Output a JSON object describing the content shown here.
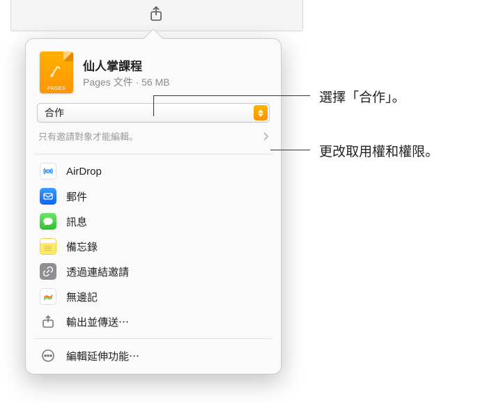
{
  "document": {
    "title": "仙人掌課程",
    "type_label": "Pages 文件",
    "size": "56 MB",
    "icon_badge": "PAGES"
  },
  "collab_dropdown": {
    "selected": "合作"
  },
  "permission_row": {
    "text": "只有邀請對象才能編輯。"
  },
  "share_options": [
    {
      "id": "airdrop",
      "label": "AirDrop",
      "icon": "airdrop"
    },
    {
      "id": "mail",
      "label": "郵件",
      "icon": "mail"
    },
    {
      "id": "messages",
      "label": "訊息",
      "icon": "messages"
    },
    {
      "id": "notes",
      "label": "備忘錄",
      "icon": "notes"
    },
    {
      "id": "link",
      "label": "透過連結邀請",
      "icon": "link"
    },
    {
      "id": "freeform",
      "label": "無邊記",
      "icon": "freeform"
    }
  ],
  "export_option": {
    "label": "輸出並傳送⋯",
    "icon": "export"
  },
  "edit_extensions": {
    "label": "編輯延伸功能⋯",
    "icon": "more"
  },
  "callouts": {
    "collab": "選擇「合作」。",
    "permission": "更改取用權和權限。"
  }
}
